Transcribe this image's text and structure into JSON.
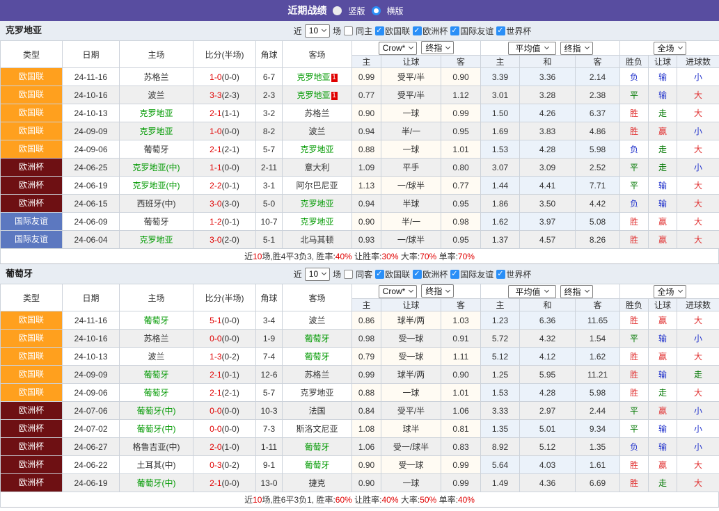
{
  "header": {
    "title": "近期战绩",
    "vertical_label": "竖版",
    "horizontal_label": "横版"
  },
  "filter": {
    "near_label": "近",
    "matches_value": "10",
    "matches_label": "场",
    "leagues": [
      "欧国联",
      "欧洲杯",
      "国际友谊",
      "世界杯"
    ]
  },
  "odds_header": {
    "bookmaker": "Crow*",
    "final": "终指",
    "average": "平均值",
    "final2": "终指",
    "scope": "全场"
  },
  "columns": [
    "类型",
    "日期",
    "主场",
    "比分(半场)",
    "角球",
    "客场",
    "主",
    "让球",
    "客",
    "主",
    "和",
    "客",
    "胜负",
    "让球",
    "进球数"
  ],
  "league_colors": {
    "欧国联": "#ffa01e",
    "欧洲杯": "#6e1013",
    "国际友谊": "#5c78c0"
  },
  "sections": [
    {
      "team": "克罗地亚",
      "same_label": "同主",
      "rows": [
        {
          "league": "欧国联",
          "date": "24-11-16",
          "home": {
            "name": "苏格兰",
            "focus": false
          },
          "score": "1-0",
          "half": "(0-0)",
          "corners": "6-7",
          "away": {
            "name": "克罗地亚",
            "focus": true,
            "badge": "1"
          },
          "odds": [
            "0.99",
            "受平/半",
            "0.90"
          ],
          "avg": [
            "3.39",
            "3.36",
            "2.14"
          ],
          "results": [
            [
              "负",
              "b"
            ],
            [
              "输",
              "b"
            ],
            [
              "小",
              "b"
            ]
          ]
        },
        {
          "league": "欧国联",
          "date": "24-10-16",
          "home": {
            "name": "波兰",
            "focus": false
          },
          "score": "3-3",
          "half": "(2-3)",
          "corners": "2-3",
          "away": {
            "name": "克罗地亚",
            "focus": true,
            "badge": "1"
          },
          "odds": [
            "0.77",
            "受平/半",
            "1.12"
          ],
          "avg": [
            "3.01",
            "3.28",
            "2.38"
          ],
          "results": [
            [
              "平",
              "g"
            ],
            [
              "输",
              "b"
            ],
            [
              "大",
              "r"
            ]
          ]
        },
        {
          "league": "欧国联",
          "date": "24-10-13",
          "home": {
            "name": "克罗地亚",
            "focus": true
          },
          "score": "2-1",
          "half": "(1-1)",
          "corners": "3-2",
          "away": {
            "name": "苏格兰",
            "focus": false
          },
          "odds": [
            "0.90",
            "一球",
            "0.99"
          ],
          "avg": [
            "1.50",
            "4.26",
            "6.37"
          ],
          "results": [
            [
              "胜",
              "r"
            ],
            [
              "走",
              "g"
            ],
            [
              "大",
              "r"
            ]
          ]
        },
        {
          "league": "欧国联",
          "date": "24-09-09",
          "home": {
            "name": "克罗地亚",
            "focus": true
          },
          "score": "1-0",
          "half": "(0-0)",
          "corners": "8-2",
          "away": {
            "name": "波兰",
            "focus": false
          },
          "odds": [
            "0.94",
            "半/一",
            "0.95"
          ],
          "avg": [
            "1.69",
            "3.83",
            "4.86"
          ],
          "results": [
            [
              "胜",
              "r"
            ],
            [
              "赢",
              "r"
            ],
            [
              "小",
              "b"
            ]
          ]
        },
        {
          "league": "欧国联",
          "date": "24-09-06",
          "home": {
            "name": "葡萄牙",
            "focus": false
          },
          "score": "2-1",
          "half": "(2-1)",
          "corners": "5-7",
          "away": {
            "name": "克罗地亚",
            "focus": true
          },
          "odds": [
            "0.88",
            "一球",
            "1.01"
          ],
          "avg": [
            "1.53",
            "4.28",
            "5.98"
          ],
          "results": [
            [
              "负",
              "b"
            ],
            [
              "走",
              "g"
            ],
            [
              "大",
              "r"
            ]
          ]
        },
        {
          "league": "欧洲杯",
          "date": "24-06-25",
          "home": {
            "name": "克罗地亚(中)",
            "focus": true
          },
          "score": "1-1",
          "half": "(0-0)",
          "corners": "2-11",
          "away": {
            "name": "意大利",
            "focus": false
          },
          "odds": [
            "1.09",
            "平手",
            "0.80"
          ],
          "avg": [
            "3.07",
            "3.09",
            "2.52"
          ],
          "results": [
            [
              "平",
              "g"
            ],
            [
              "走",
              "g"
            ],
            [
              "小",
              "b"
            ]
          ]
        },
        {
          "league": "欧洲杯",
          "date": "24-06-19",
          "home": {
            "name": "克罗地亚(中)",
            "focus": true
          },
          "score": "2-2",
          "half": "(0-1)",
          "corners": "3-1",
          "away": {
            "name": "阿尔巴尼亚",
            "focus": false
          },
          "odds": [
            "1.13",
            "一/球半",
            "0.77"
          ],
          "avg": [
            "1.44",
            "4.41",
            "7.71"
          ],
          "results": [
            [
              "平",
              "g"
            ],
            [
              "输",
              "b"
            ],
            [
              "大",
              "r"
            ]
          ]
        },
        {
          "league": "欧洲杯",
          "date": "24-06-15",
          "home": {
            "name": "西班牙(中)",
            "focus": false
          },
          "score": "3-0",
          "half": "(3-0)",
          "corners": "5-0",
          "away": {
            "name": "克罗地亚",
            "focus": true
          },
          "odds": [
            "0.94",
            "半球",
            "0.95"
          ],
          "avg": [
            "1.86",
            "3.50",
            "4.42"
          ],
          "results": [
            [
              "负",
              "b"
            ],
            [
              "输",
              "b"
            ],
            [
              "大",
              "r"
            ]
          ]
        },
        {
          "league": "国际友谊",
          "date": "24-06-09",
          "home": {
            "name": "葡萄牙",
            "focus": false
          },
          "score": "1-2",
          "half": "(0-1)",
          "corners": "10-7",
          "away": {
            "name": "克罗地亚",
            "focus": true
          },
          "odds": [
            "0.90",
            "半/一",
            "0.98"
          ],
          "avg": [
            "1.62",
            "3.97",
            "5.08"
          ],
          "results": [
            [
              "胜",
              "r"
            ],
            [
              "赢",
              "r"
            ],
            [
              "大",
              "r"
            ]
          ]
        },
        {
          "league": "国际友谊",
          "date": "24-06-04",
          "home": {
            "name": "克罗地亚",
            "focus": true
          },
          "score": "3-0",
          "half": "(2-0)",
          "corners": "5-1",
          "away": {
            "name": "北马其顿",
            "focus": false
          },
          "odds": [
            "0.93",
            "一/球半",
            "0.95"
          ],
          "avg": [
            "1.37",
            "4.57",
            "8.26"
          ],
          "results": [
            [
              "胜",
              "r"
            ],
            [
              "赢",
              "r"
            ],
            [
              "大",
              "r"
            ]
          ]
        }
      ],
      "summary": [
        [
          "近",
          "k"
        ],
        [
          "10",
          "r"
        ],
        [
          "场,胜4平3负3, 胜率:",
          "k"
        ],
        [
          "40%",
          "r"
        ],
        [
          " 让胜率:",
          "k"
        ],
        [
          "30%",
          "r"
        ],
        [
          " 大率:",
          "k"
        ],
        [
          "70%",
          "r"
        ],
        [
          " 单率:",
          "k"
        ],
        [
          "70%",
          "r"
        ]
      ]
    },
    {
      "team": "葡萄牙",
      "same_label": "同客",
      "rows": [
        {
          "league": "欧国联",
          "date": "24-11-16",
          "home": {
            "name": "葡萄牙",
            "focus": true
          },
          "score": "5-1",
          "half": "(0-0)",
          "corners": "3-4",
          "away": {
            "name": "波兰",
            "focus": false
          },
          "odds": [
            "0.86",
            "球半/两",
            "1.03"
          ],
          "avg": [
            "1.23",
            "6.36",
            "11.65"
          ],
          "results": [
            [
              "胜",
              "r"
            ],
            [
              "赢",
              "r"
            ],
            [
              "大",
              "r"
            ]
          ]
        },
        {
          "league": "欧国联",
          "date": "24-10-16",
          "home": {
            "name": "苏格兰",
            "focus": false
          },
          "score": "0-0",
          "half": "(0-0)",
          "corners": "1-9",
          "away": {
            "name": "葡萄牙",
            "focus": true
          },
          "odds": [
            "0.98",
            "受一球",
            "0.91"
          ],
          "avg": [
            "5.72",
            "4.32",
            "1.54"
          ],
          "results": [
            [
              "平",
              "g"
            ],
            [
              "输",
              "b"
            ],
            [
              "小",
              "b"
            ]
          ]
        },
        {
          "league": "欧国联",
          "date": "24-10-13",
          "home": {
            "name": "波兰",
            "focus": false
          },
          "score": "1-3",
          "half": "(0-2)",
          "corners": "7-4",
          "away": {
            "name": "葡萄牙",
            "focus": true
          },
          "odds": [
            "0.79",
            "受一球",
            "1.11"
          ],
          "avg": [
            "5.12",
            "4.12",
            "1.62"
          ],
          "results": [
            [
              "胜",
              "r"
            ],
            [
              "赢",
              "r"
            ],
            [
              "大",
              "r"
            ]
          ]
        },
        {
          "league": "欧国联",
          "date": "24-09-09",
          "home": {
            "name": "葡萄牙",
            "focus": true
          },
          "score": "2-1",
          "half": "(0-1)",
          "corners": "12-6",
          "away": {
            "name": "苏格兰",
            "focus": false
          },
          "odds": [
            "0.99",
            "球半/两",
            "0.90"
          ],
          "avg": [
            "1.25",
            "5.95",
            "11.21"
          ],
          "results": [
            [
              "胜",
              "r"
            ],
            [
              "输",
              "b"
            ],
            [
              "走",
              "g"
            ]
          ]
        },
        {
          "league": "欧国联",
          "date": "24-09-06",
          "home": {
            "name": "葡萄牙",
            "focus": true
          },
          "score": "2-1",
          "half": "(2-1)",
          "corners": "5-7",
          "away": {
            "name": "克罗地亚",
            "focus": false
          },
          "odds": [
            "0.88",
            "一球",
            "1.01"
          ],
          "avg": [
            "1.53",
            "4.28",
            "5.98"
          ],
          "results": [
            [
              "胜",
              "r"
            ],
            [
              "走",
              "g"
            ],
            [
              "大",
              "r"
            ]
          ]
        },
        {
          "league": "欧洲杯",
          "date": "24-07-06",
          "home": {
            "name": "葡萄牙(中)",
            "focus": true
          },
          "score": "0-0",
          "half": "(0-0)",
          "corners": "10-3",
          "away": {
            "name": "法国",
            "focus": false
          },
          "odds": [
            "0.84",
            "受平/半",
            "1.06"
          ],
          "avg": [
            "3.33",
            "2.97",
            "2.44"
          ],
          "results": [
            [
              "平",
              "g"
            ],
            [
              "赢",
              "r"
            ],
            [
              "小",
              "b"
            ]
          ]
        },
        {
          "league": "欧洲杯",
          "date": "24-07-02",
          "home": {
            "name": "葡萄牙(中)",
            "focus": true
          },
          "score": "0-0",
          "half": "(0-0)",
          "corners": "7-3",
          "away": {
            "name": "斯洛文尼亚",
            "focus": false
          },
          "odds": [
            "1.08",
            "球半",
            "0.81"
          ],
          "avg": [
            "1.35",
            "5.01",
            "9.34"
          ],
          "results": [
            [
              "平",
              "g"
            ],
            [
              "输",
              "b"
            ],
            [
              "小",
              "b"
            ]
          ]
        },
        {
          "league": "欧洲杯",
          "date": "24-06-27",
          "home": {
            "name": "格鲁吉亚(中)",
            "focus": false
          },
          "score": "2-0",
          "half": "(1-0)",
          "corners": "1-11",
          "away": {
            "name": "葡萄牙",
            "focus": true
          },
          "odds": [
            "1.06",
            "受一/球半",
            "0.83"
          ],
          "avg": [
            "8.92",
            "5.12",
            "1.35"
          ],
          "results": [
            [
              "负",
              "b"
            ],
            [
              "输",
              "b"
            ],
            [
              "小",
              "b"
            ]
          ]
        },
        {
          "league": "欧洲杯",
          "date": "24-06-22",
          "home": {
            "name": "土耳其(中)",
            "focus": false
          },
          "score": "0-3",
          "half": "(0-2)",
          "corners": "9-1",
          "away": {
            "name": "葡萄牙",
            "focus": true
          },
          "odds": [
            "0.90",
            "受一球",
            "0.99"
          ],
          "avg": [
            "5.64",
            "4.03",
            "1.61"
          ],
          "results": [
            [
              "胜",
              "r"
            ],
            [
              "赢",
              "r"
            ],
            [
              "大",
              "r"
            ]
          ]
        },
        {
          "league": "欧洲杯",
          "date": "24-06-19",
          "home": {
            "name": "葡萄牙(中)",
            "focus": true
          },
          "score": "2-1",
          "half": "(0-0)",
          "corners": "13-0",
          "away": {
            "name": "捷克",
            "focus": false
          },
          "odds": [
            "0.90",
            "一球",
            "0.99"
          ],
          "avg": [
            "1.49",
            "4.36",
            "6.69"
          ],
          "results": [
            [
              "胜",
              "r"
            ],
            [
              "走",
              "g"
            ],
            [
              "大",
              "r"
            ]
          ]
        }
      ],
      "summary": [
        [
          "近",
          "k"
        ],
        [
          "10",
          "r"
        ],
        [
          "场,胜6平3负1, 胜率:",
          "k"
        ],
        [
          "60%",
          "r"
        ],
        [
          " 让胜率:",
          "k"
        ],
        [
          "40%",
          "r"
        ],
        [
          " 大率:",
          "k"
        ],
        [
          "50%",
          "r"
        ],
        [
          " 单率:",
          "k"
        ],
        [
          "40%",
          "r"
        ]
      ]
    }
  ]
}
